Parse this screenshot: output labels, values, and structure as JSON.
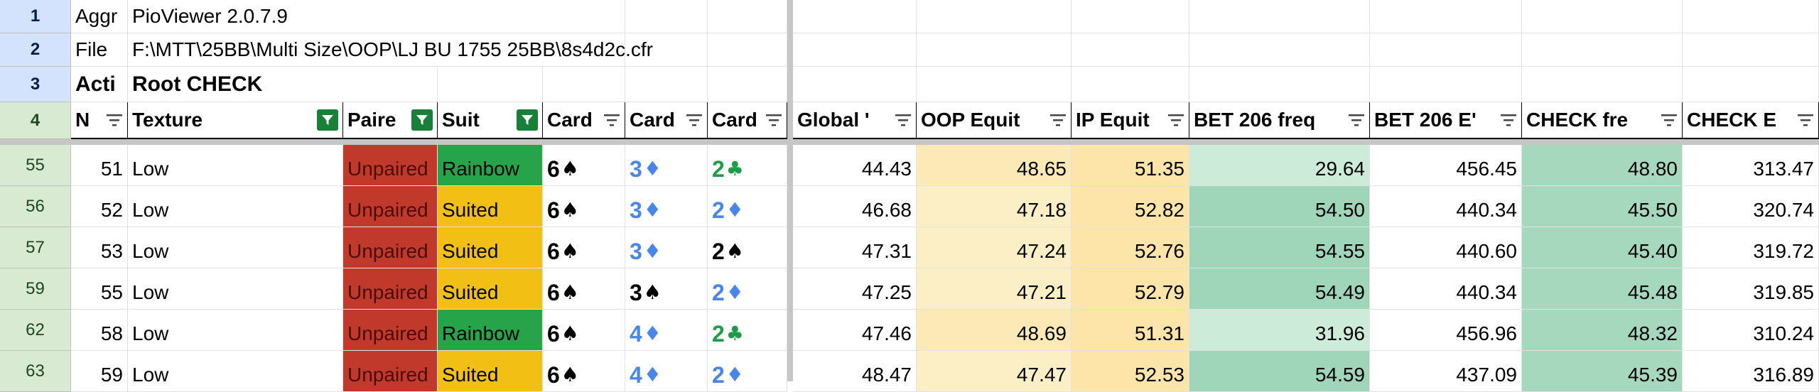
{
  "colors": {
    "unpaired": "#c0392b",
    "rainbow": "#27a34a",
    "suited": "#f2c014",
    "spade": "#000000",
    "diamond": "#4a86e8",
    "club": "#1e9c4a",
    "oop_bg": "#fde9b5",
    "oop_bg_alt": "#fcefc6",
    "ip_bg": "#fde4a8",
    "bet_freq_light": "#cdebd9",
    "bet_freq_dark": "#9fd5b9",
    "check_freq": "#a5d8bd"
  },
  "top": {
    "r1": {
      "num": "1",
      "a": "Aggr",
      "b": "PioViewer 2.0.7.9"
    },
    "r2": {
      "num": "2",
      "a": "File",
      "b": "F:\\MTT\\25BB\\Multi Size\\OOP\\LJ BU 1755 25BB\\8s4d2c.cfr"
    },
    "r3": {
      "num": "3",
      "a": "Acti",
      "b": "Root CHECK"
    }
  },
  "headers": {
    "num": "4",
    "cols": [
      "N",
      "Texture",
      "Paire",
      "Suit",
      "Card",
      "Card",
      "Card",
      "Global '",
      "OOP Equit",
      "IP Equit",
      "BET 206 freq",
      "BET 206 E'",
      "CHECK fre",
      "CHECK E"
    ]
  },
  "rows": [
    {
      "num": "55",
      "n": "51",
      "texture": "Low",
      "paired": "Unpaired",
      "suit": "Rainbow",
      "c1": {
        "rank": "6",
        "suit": "♠"
      },
      "c2": {
        "rank": "3",
        "suit": "♦"
      },
      "c3": {
        "rank": "2",
        "suit": "♣"
      },
      "global": "44.43",
      "oop": "48.65",
      "ip": "51.35",
      "bet_freq": "29.64",
      "bet_ev": "456.45",
      "check_freq": "48.80",
      "check_ev": "313.47"
    },
    {
      "num": "56",
      "n": "52",
      "texture": "Low",
      "paired": "Unpaired",
      "suit": "Suited",
      "c1": {
        "rank": "6",
        "suit": "♠"
      },
      "c2": {
        "rank": "3",
        "suit": "♦"
      },
      "c3": {
        "rank": "2",
        "suit": "♦"
      },
      "global": "46.68",
      "oop": "47.18",
      "ip": "52.82",
      "bet_freq": "54.50",
      "bet_ev": "440.34",
      "check_freq": "45.50",
      "check_ev": "320.74"
    },
    {
      "num": "57",
      "n": "53",
      "texture": "Low",
      "paired": "Unpaired",
      "suit": "Suited",
      "c1": {
        "rank": "6",
        "suit": "♠"
      },
      "c2": {
        "rank": "3",
        "suit": "♦"
      },
      "c3": {
        "rank": "2",
        "suit": "♠"
      },
      "global": "47.31",
      "oop": "47.24",
      "ip": "52.76",
      "bet_freq": "54.55",
      "bet_ev": "440.60",
      "check_freq": "45.40",
      "check_ev": "319.72"
    },
    {
      "num": "59",
      "n": "55",
      "texture": "Low",
      "paired": "Unpaired",
      "suit": "Suited",
      "c1": {
        "rank": "6",
        "suit": "♠"
      },
      "c2": {
        "rank": "3",
        "suit": "♠"
      },
      "c3": {
        "rank": "2",
        "suit": "♦"
      },
      "global": "47.25",
      "oop": "47.21",
      "ip": "52.79",
      "bet_freq": "54.49",
      "bet_ev": "440.34",
      "check_freq": "45.48",
      "check_ev": "319.85"
    },
    {
      "num": "62",
      "n": "58",
      "texture": "Low",
      "paired": "Unpaired",
      "suit": "Rainbow",
      "c1": {
        "rank": "6",
        "suit": "♠"
      },
      "c2": {
        "rank": "4",
        "suit": "♦"
      },
      "c3": {
        "rank": "2",
        "suit": "♣"
      },
      "global": "47.46",
      "oop": "48.69",
      "ip": "51.31",
      "bet_freq": "31.96",
      "bet_ev": "456.96",
      "check_freq": "48.32",
      "check_ev": "310.24"
    },
    {
      "num": "63",
      "n": "59",
      "texture": "Low",
      "paired": "Unpaired",
      "suit": "Suited",
      "c1": {
        "rank": "6",
        "suit": "♠"
      },
      "c2": {
        "rank": "4",
        "suit": "♦"
      },
      "c3": {
        "rank": "2",
        "suit": "♦"
      },
      "global": "48.47",
      "oop": "47.47",
      "ip": "52.53",
      "bet_freq": "54.59",
      "bet_ev": "437.09",
      "check_freq": "45.39",
      "check_ev": "316.89"
    }
  ]
}
